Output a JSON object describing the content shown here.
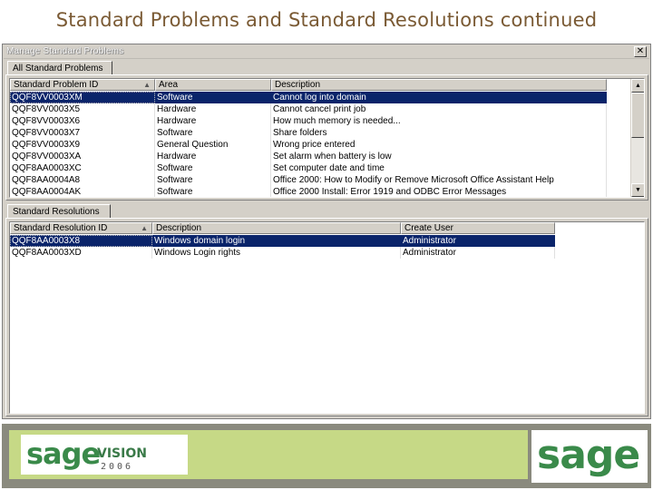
{
  "slide_title": "Standard Problems and Standard Resolutions continued",
  "window": {
    "title": "Manage Standard Problems",
    "close_glyph": "✕"
  },
  "problems_tab": {
    "label": "All Standard Problems"
  },
  "problems_table": {
    "columns": [
      "Standard Problem ID",
      "Area",
      "Description"
    ],
    "sort_glyph": "▲",
    "rows": [
      [
        "QQF8VV0003XM",
        "Software",
        "Cannot log into domain"
      ],
      [
        "QQF8VV0003X5",
        "Hardware",
        "Cannot cancel print job"
      ],
      [
        "QQF8VV0003X6",
        "Hardware",
        "How much memory is needed..."
      ],
      [
        "QQF8VV0003X7",
        "Software",
        "Share folders"
      ],
      [
        "QQF8VV0003X9",
        "General Question",
        "Wrong price entered"
      ],
      [
        "QQF8VV0003XA",
        "Hardware",
        "Set alarm when battery is low"
      ],
      [
        "QQF8AA0003XC",
        "Software",
        "Set computer date and time"
      ],
      [
        "QQF8AA0004A8",
        "Software",
        "Office 2000: How to Modify or Remove Microsoft Office Assistant Help"
      ],
      [
        "QQF8AA0004AK",
        "Software",
        "Office 2000 Install: Error 1919 and ODBC Error Messages"
      ]
    ]
  },
  "resolutions_tab": {
    "label": "Standard Resolutions"
  },
  "resolutions_table": {
    "columns": [
      "Standard Resolution ID",
      "Description",
      "Create User"
    ],
    "rows": [
      [
        "QQF8AA0003X8",
        "Windows domain login",
        "Administrator"
      ],
      [
        "QQF8AA0003XD",
        "Windows Login rights",
        "Administrator"
      ]
    ]
  },
  "scrollbar": {
    "up_glyph": "▲",
    "down_glyph": "▼"
  },
  "footer": {
    "left_logo": {
      "sage": "sage",
      "vision": "VISION",
      "year": "2006"
    },
    "right_logo": {
      "sage": "sage"
    },
    "colors": {
      "band": "#c6d986",
      "frame": "#8a8a7e",
      "logo_green": "#3a8a4a"
    }
  }
}
